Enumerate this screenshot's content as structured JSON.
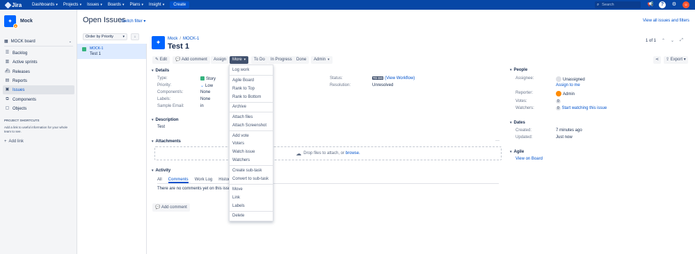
{
  "topnav": {
    "logo": "Jira",
    "items": [
      "Dashboards",
      "Projects",
      "Issues",
      "Boards",
      "Plans",
      "Insight"
    ],
    "create": "Create",
    "search_placeholder": "Search"
  },
  "sidebar": {
    "project_name": "Mock",
    "board": "MOCK board",
    "items": [
      "Backlog",
      "Active sprints",
      "Releases",
      "Reports",
      "Issues",
      "Components",
      "Objects"
    ],
    "shortcuts_heading": "PROJECT SHORTCUTS",
    "shortcuts_text": "Add a link to useful information for your whole team to see.",
    "add_link": "Add link"
  },
  "list": {
    "title": "Open Issues",
    "switch_filter": "Switch filter",
    "view_all": "View all issues and filters",
    "order_by": "Order by Priority",
    "rows": [
      {
        "key": "MOCK-1",
        "summary": "Test 1"
      }
    ]
  },
  "issue": {
    "project": "Mock",
    "key": "MOCK-1",
    "title": "Test 1",
    "pager": "1 of 1"
  },
  "toolbar": {
    "edit": "Edit",
    "add_comment": "Add comment",
    "assign": "Assign",
    "more": "More",
    "todo": "To Do",
    "in_progress": "In Progress",
    "done": "Done",
    "admin": "Admin",
    "export": "Export"
  },
  "more_menu": {
    "items": [
      "Log work",
      "Agile Board",
      "Rank to Top",
      "Rank to Bottom",
      "Archive",
      "Attach files",
      "Attach Screenshot",
      "Add vote",
      "Voters",
      "Watch issue",
      "Watchers",
      "Create sub-task",
      "Convert to sub-task",
      "Move",
      "Link",
      "Labels",
      "Delete"
    ]
  },
  "details": {
    "heading": "Details",
    "type_label": "Type:",
    "type_value": "Story",
    "priority_label": "Priority:",
    "priority_value": "Low",
    "components_label": "Component/s:",
    "components_value": "None",
    "labels_label": "Labels:",
    "labels_value": "None",
    "sample_email_label": "Sample Email:",
    "sample_email_value": "in",
    "status_label": "Status:",
    "status_value": "TO DO",
    "view_workflow": "(View Workflow)",
    "resolution_label": "Resolution:",
    "resolution_value": "Unresolved"
  },
  "description": {
    "heading": "Description",
    "text": "Test"
  },
  "attachments": {
    "heading": "Attachments",
    "drop_text": "Drop files to attach, or",
    "browse": "browse."
  },
  "activity": {
    "heading": "Activity",
    "tabs": [
      "All",
      "Comments",
      "Work Log",
      "History"
    ],
    "empty": "There are no comments yet on this issue.",
    "add_comment": "Add comment"
  },
  "people": {
    "heading": "People",
    "assignee_label": "Assignee:",
    "assignee_value": "Unassigned",
    "assign_to_me": "Assign to me",
    "reporter_label": "Reporter:",
    "reporter_value": "Admin",
    "votes_label": "Votes:",
    "votes_value": "0",
    "watchers_label": "Watchers:",
    "watchers_value": "0",
    "start_watching": "Start watching this issue"
  },
  "dates": {
    "heading": "Dates",
    "created_label": "Created:",
    "created_value": "7 minutes ago",
    "updated_label": "Updated:",
    "updated_value": "Just now"
  },
  "agile": {
    "heading": "Agile",
    "view_on_board": "View on Board"
  },
  "colors": {
    "nav": "#0747a6",
    "accent": "#0052cc",
    "story": "#36b37e"
  }
}
